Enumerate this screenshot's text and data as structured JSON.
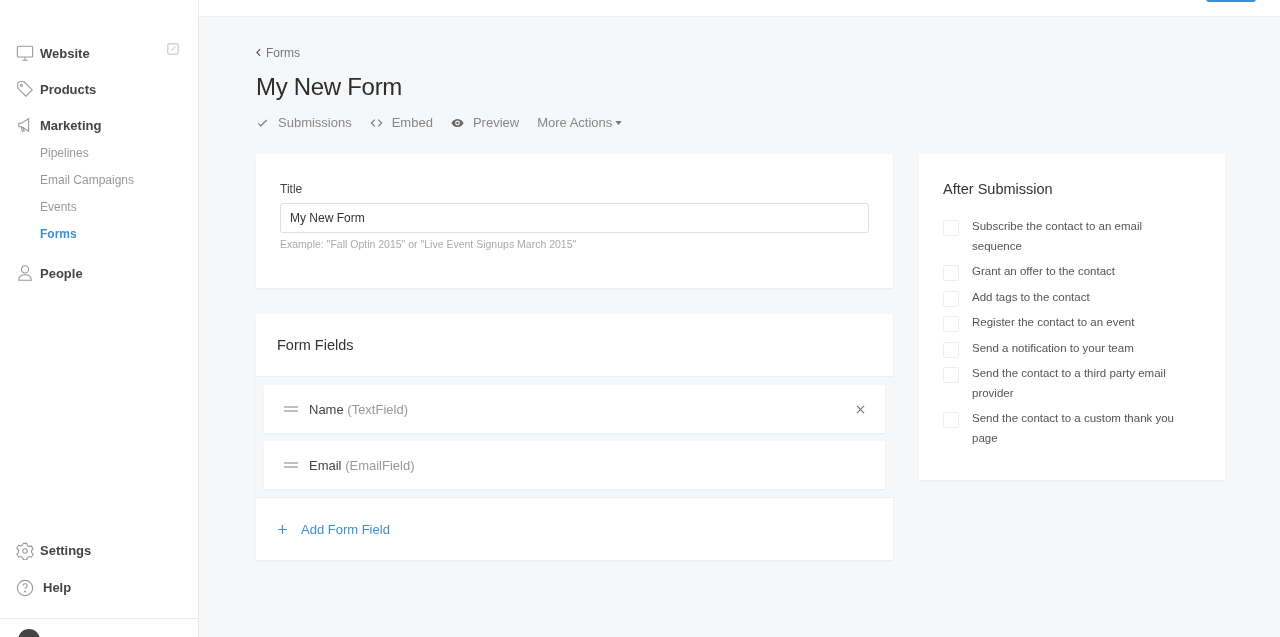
{
  "sidebar": {
    "items": [
      {
        "kind": "main",
        "label": "Website",
        "external": true,
        "selected": false
      },
      {
        "kind": "main",
        "label": "Products",
        "external": false,
        "selected": false
      },
      {
        "kind": "main",
        "label": "Marketing",
        "external": false,
        "selected": false
      },
      {
        "kind": "sub",
        "label": "Pipelines",
        "selected": false
      },
      {
        "kind": "sub",
        "label": "Email Campaigns",
        "selected": false
      },
      {
        "kind": "sub",
        "label": "Events",
        "selected": false
      },
      {
        "kind": "sub",
        "label": "Forms",
        "selected": true
      },
      {
        "kind": "main",
        "label": "People",
        "external": false,
        "selected": false
      }
    ],
    "footer_items": [
      {
        "label": "Settings"
      },
      {
        "label": "Help"
      }
    ]
  },
  "breadcrumb": "Forms",
  "page_title": "My New Form",
  "actions": [
    {
      "kind": "check",
      "label": "Submissions"
    },
    {
      "kind": "code",
      "label": "Embed"
    },
    {
      "kind": "eye",
      "label": "Preview"
    },
    {
      "kind": "dropdown",
      "label": "More Actions"
    }
  ],
  "title_card": {
    "label": "Title",
    "value": "My New Form",
    "hint": "Example: \"Fall Optin 2015\" or \"Live Event Signups March 2015\""
  },
  "form_fields": {
    "heading": "Form Fields",
    "fields": [
      {
        "name": "Name",
        "type": "(TextField)",
        "removable": true
      },
      {
        "name": "Email",
        "type": "(EmailField)",
        "removable": false
      }
    ],
    "add_label": "Add Form Field"
  },
  "after_submission": {
    "heading": "After Submission",
    "options": [
      {
        "label": "Subscribe the contact to an email sequence",
        "checked": false
      },
      {
        "label": "Grant an offer to the contact",
        "checked": false
      },
      {
        "label": "Add tags to the contact",
        "checked": false
      },
      {
        "label": "Register the contact to an event",
        "checked": false
      },
      {
        "label": "Send a notification to your team",
        "checked": false
      },
      {
        "label": "Send the contact to a third party email provider",
        "checked": false
      },
      {
        "label": "Send the contact to a custom thank you page",
        "checked": false
      }
    ]
  }
}
